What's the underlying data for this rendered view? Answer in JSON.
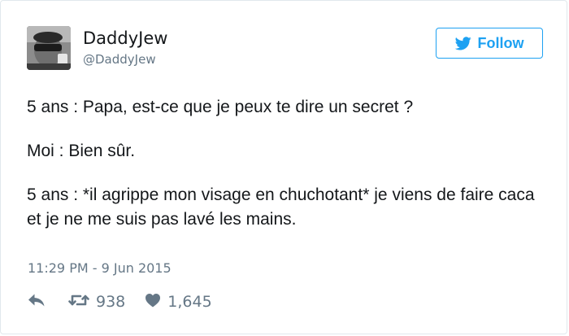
{
  "author": {
    "display_name": "DaddyJew",
    "screen_name": "@DaddyJew"
  },
  "follow_button": {
    "label": "Follow",
    "icon": "twitter-bird-icon"
  },
  "tweet": {
    "paragraphs": [
      "5 ans : Papa, est-ce que je peux te dire un secret ?",
      "Moi : Bien sûr.",
      "5 ans : *il agrippe mon visage en chuchotant* je viens de faire caca et je ne me suis pas lavé les mains."
    ],
    "timestamp": "11:29 PM - 9 Jun 2015"
  },
  "actions": {
    "reply": {
      "icon": "reply-icon"
    },
    "retweet": {
      "icon": "retweet-icon",
      "count": "938"
    },
    "like": {
      "icon": "heart-icon",
      "count": "1,645"
    }
  },
  "colors": {
    "accent": "#1da1f2",
    "text": "#14171a",
    "secondary": "#657786",
    "border": "#e1e8ed"
  }
}
